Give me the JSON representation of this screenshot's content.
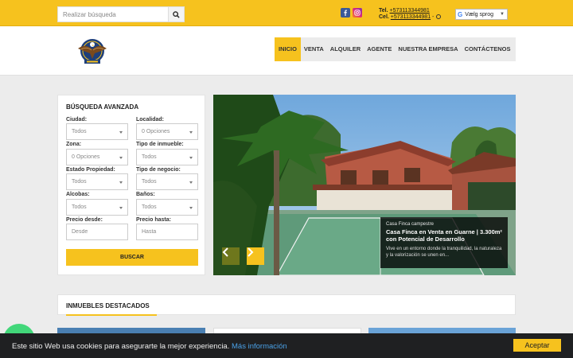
{
  "topbar": {
    "search_placeholder": "Realizar búsqueda",
    "tel_label": "Tel.",
    "tel_number": "+573113344981",
    "cel_label": "Cel.",
    "cel_number": "+573113344981",
    "translate_label": "Vælg sprog",
    "icons": [
      "search-icon",
      "facebook-icon",
      "instagram-icon",
      "whatsapp-icon",
      "google-translate-icon"
    ]
  },
  "nav": {
    "items": [
      {
        "label": "INICIO",
        "active": true
      },
      {
        "label": "VENTA",
        "active": false
      },
      {
        "label": "ALQUILER",
        "active": false
      },
      {
        "label": "AGENTE",
        "active": false
      },
      {
        "label": "NUESTRA EMPRESA",
        "active": false
      },
      {
        "label": "CONTÁCTENOS",
        "active": false
      }
    ]
  },
  "search_panel": {
    "title": "BÚSQUEDA AVANZADA",
    "ciudad_label": "Ciudad:",
    "ciudad_value": "Todos",
    "localidad_label": "Localidad:",
    "localidad_value": "0 Opciones",
    "zona_label": "Zona:",
    "zona_value": "0 Opciones",
    "tipo_inmueble_label": "Tipo de inmueble:",
    "tipo_inmueble_value": "Todos",
    "estado_label": "Estado Propiedad:",
    "estado_value": "Todos",
    "tipo_negocio_label": "Tipo de negocio:",
    "tipo_negocio_value": "Todos",
    "alcobas_label": "Alcobas:",
    "alcobas_value": "Todos",
    "banos_label": "Baños:",
    "banos_value": "Todos",
    "precio_desde_label": "Precio desde:",
    "precio_desde_placeholder": "Desde",
    "precio_hasta_label": "Precio hasta:",
    "precio_hasta_placeholder": "Hasta",
    "button": "BUSCAR"
  },
  "slider": {
    "category": "Casa Finca campestre",
    "title": "Casa Finca en Venta en Guarne | 3.300m² con Potencial de Desarrollo",
    "description": "Vive en un entorno donde la tranquilidad, la naturaleza y la valorización se unen en..."
  },
  "featured": {
    "title": "INMUEBLES DESTACADOS"
  },
  "cookie": {
    "text": "Este sitio Web usa cookies para asegurarte la mejor experiencia.",
    "link": "Más información",
    "accept": "Aceptar"
  },
  "colors": {
    "accent": "#f6c21e",
    "cookie_bg": "#1f2022",
    "link": "#4aa0e6"
  }
}
